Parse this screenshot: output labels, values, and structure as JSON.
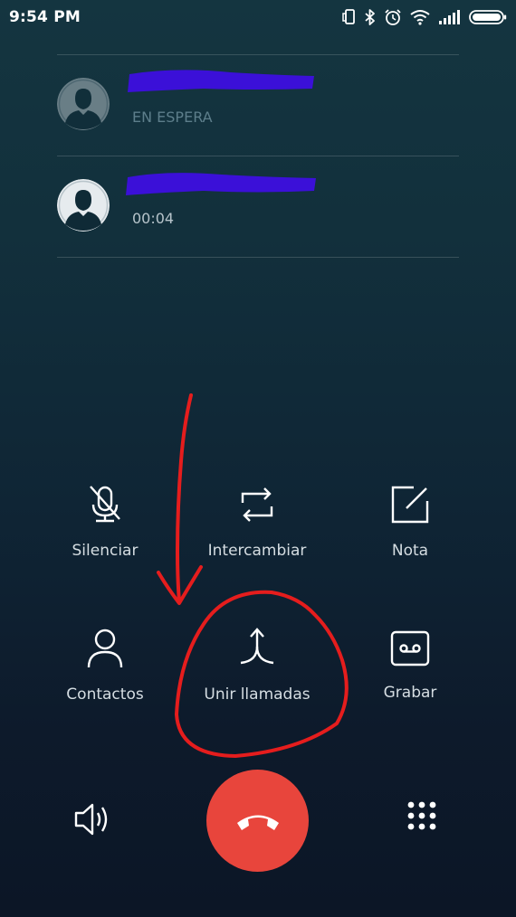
{
  "status_bar": {
    "time": "9:54 PM",
    "icons": [
      "vibrate-icon",
      "bluetooth-icon",
      "alarm-icon",
      "wifi-icon",
      "signal-icon",
      "battery-icon"
    ]
  },
  "calls": [
    {
      "status": "EN ESPERA",
      "state": "held"
    },
    {
      "status": "00:04",
      "state": "active"
    }
  ],
  "actions": {
    "mute": {
      "label": "Silenciar",
      "icon": "mic-off-icon"
    },
    "swap": {
      "label": "Intercambiar",
      "icon": "swap-icon"
    },
    "note": {
      "label": "Nota",
      "icon": "note-icon"
    },
    "contacts": {
      "label": "Contactos",
      "icon": "person-icon"
    },
    "merge": {
      "label": "Unir llamadas",
      "icon": "merge-icon"
    },
    "record": {
      "label": "Grabar",
      "icon": "tape-icon"
    }
  },
  "bottom_bar": {
    "speaker_icon": "speaker-icon",
    "end_call_icon": "phone-hangup-icon",
    "dialpad_icon": "dialpad-icon"
  },
  "colors": {
    "end_call": "#e8453c",
    "redaction": "#3b10d8",
    "annotation": "#e51d1d",
    "held_status": "#5d7e8b"
  }
}
